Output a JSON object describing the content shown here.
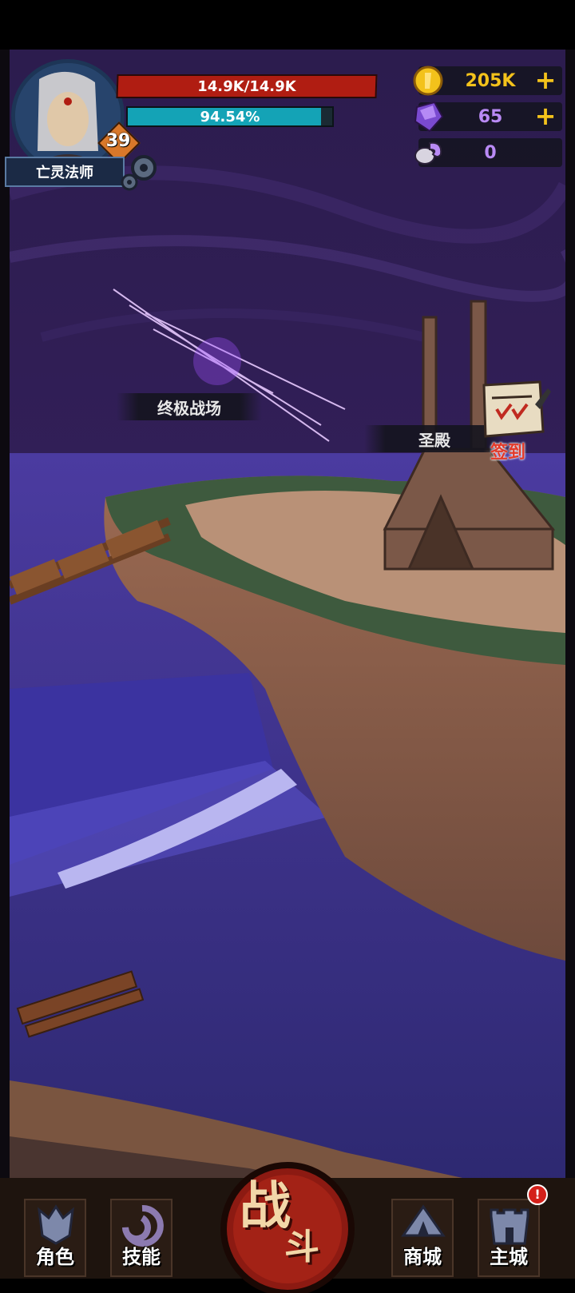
{
  "player": {
    "hp_text": "14.9K/14.9K",
    "hp_fraction": 1.0,
    "mp_text": "94.54%",
    "mp_fraction": 0.9454,
    "level": "39",
    "class_name": "亡灵法师"
  },
  "resources": {
    "gold": {
      "value": "205K",
      "icon": "gold-coin-icon",
      "plus": "+"
    },
    "gems": {
      "value": "65",
      "icon": "purple-crystal-icon",
      "plus": "+"
    },
    "skulls": {
      "value": "0",
      "icon": "ram-skull-icon"
    }
  },
  "map": {
    "ultimate_arena": "终极战场",
    "sanctuary": "圣殿",
    "signin": "签到"
  },
  "nav": {
    "character": "角色",
    "skills": "技能",
    "fight_a": "战",
    "fight_b": "斗",
    "shop": "商城",
    "main_city": "主城",
    "alert": "!"
  },
  "colors": {
    "hp": "#b01d12",
    "mp": "#14a3b6",
    "gold_text": "#f3c21b",
    "gem_text": "#b98af5",
    "skull_text": "#b98af5",
    "signin_text": "#e23a2a"
  }
}
